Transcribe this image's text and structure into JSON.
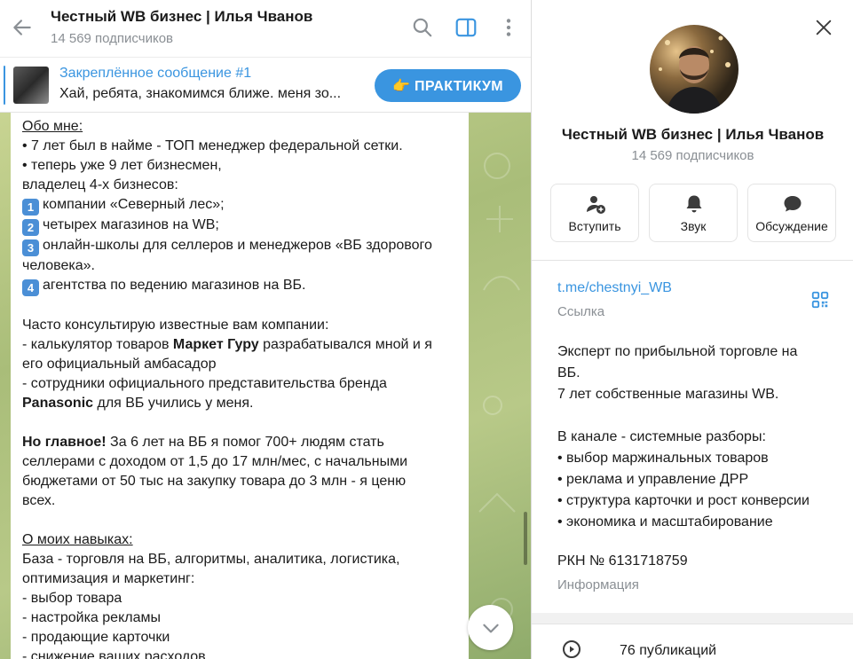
{
  "header": {
    "title": "Честный WB бизнес | Илья Чванов",
    "subscribers": "14 569 подписчиков"
  },
  "pinned": {
    "title": "Закреплённое сообщение #1",
    "text": "Хай, ребята, знакомимся ближе.  меня зо...",
    "button_label": "👉 ПРАКТИКУМ"
  },
  "message": {
    "about_heading": "Обо мне:",
    "line1": "• 7 лет был в найме - ТОП менеджер федеральной сетки.",
    "line2": "• теперь уже 9 лет бизнесмен,",
    "line3": "владелец 4-х бизнесов:",
    "item1": "компании «Северный лес»;",
    "item2": "четырех магазинов на WB;",
    "item3a": "онлайн-школы для селлеров и менеджеров «ВБ здорового",
    "item3b": "человека».",
    "item4": "агентства по ведению магазинов на ВБ.",
    "consult": "Часто консультирую известные вам компании:",
    "c1a_pre": "-  калькулятор товаров ",
    "c1a_bold": "Маркет Гуру",
    "c1a_post": " разрабатывался мной и я",
    "c1b": "его официальный амбасадор",
    "c2a": "- сотрудники официального представительства бренда",
    "c2b_bold": "Panasonic",
    "c2b_post": " для ВБ учились у меня.",
    "main_bold": "Но главное!",
    "main1": " За 6 лет на ВБ я помог 700+ людям стать",
    "main2": "селлерами с доходом от 1,5 до 17 млн/мес, с начальными",
    "main3": "бюджетами от 50 тыс на закупку товара до 3 млн - я  ценю",
    "main4": "всех.",
    "skills_heading": "О моих навыках:",
    "s1": "База - торговля на ВБ, алгоритмы, аналитика, логистика,",
    "s2": "оптимизация и маркетинг:",
    "s3": "- выбор товара",
    "s4": "- настройка рекламы",
    "s5": "- продающие карточки",
    "s6": "- снижение ваших расходов"
  },
  "profile": {
    "title": "Честный WB бизнес | Илья Чванов",
    "subscribers": "14 569 подписчиков",
    "actions": {
      "join": "Вступить",
      "sound": "Звук",
      "discuss": "Обсуждение"
    },
    "link": "t.me/chestnyi_WB",
    "link_label": "Ссылка",
    "desc1": "Эксперт по прибыльной торговле на",
    "desc2": "ВБ.",
    "desc3": "7 лет собственные магазины WB.",
    "desc4": "В канале - системные разборы:",
    "desc5": "• выбор маржинальных товаров",
    "desc6": "• реклама и управление ДРР",
    "desc7": "• структура карточки и рост конверсии",
    "desc8": "• экономика и масштабирование",
    "rkn": "РКН № 6131718759",
    "rkn_label": "Информация",
    "posts": "76 публикаций"
  },
  "colors": {
    "accent": "#3a95e0",
    "secondary_text": "#8a8f94",
    "chat_bg": "#b8c988"
  },
  "icons": [
    "back-arrow-icon",
    "search-icon",
    "sidebar-toggle-icon",
    "more-vertical-icon",
    "close-icon",
    "add-user-icon",
    "bell-icon",
    "chat-bubble-icon",
    "qr-code-icon",
    "media-play-icon",
    "chevron-down-icon"
  ]
}
